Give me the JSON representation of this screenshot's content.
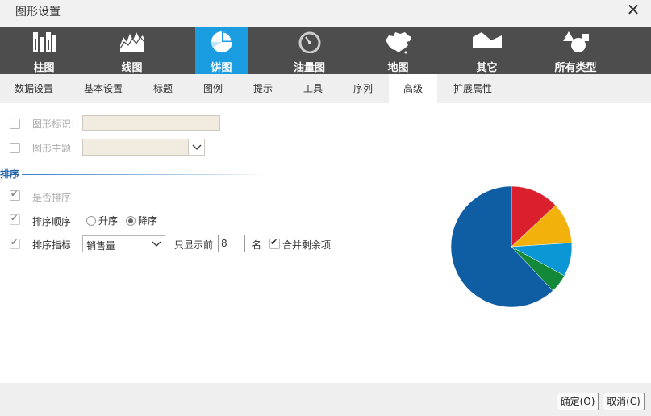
{
  "window": {
    "title": "图形设置",
    "close_icon": "close-icon"
  },
  "chart_types": [
    {
      "label": "柱图",
      "icon": "bar-chart-icon"
    },
    {
      "label": "线图",
      "icon": "line-chart-icon"
    },
    {
      "label": "饼图",
      "icon": "pie-chart-icon"
    },
    {
      "label": "油量图",
      "icon": "gauge-chart-icon"
    },
    {
      "label": "地图",
      "icon": "map-chart-icon"
    },
    {
      "label": "其它",
      "icon": "other-chart-icon"
    },
    {
      "label": "所有类型",
      "icon": "all-types-icon"
    }
  ],
  "active_chart_type": "饼图",
  "tabs": [
    "数据设置",
    "基本设置",
    "标题",
    "图例",
    "提示",
    "工具",
    "序列",
    "高级",
    "扩展属性"
  ],
  "active_tab": "高级",
  "form": {
    "chart_id_label": "图形标识:",
    "chart_id_value": "",
    "chart_theme_label": "图形主题",
    "chart_theme_value": "",
    "sort_section": "排序",
    "is_sort_label": "是否排序",
    "is_sort_checked": true,
    "sort_order_label": "排序顺序",
    "sort_asc_label": "升序",
    "sort_desc_label": "降序",
    "sort_order_selected": "降序",
    "sort_metric_label": "排序指标",
    "sort_metric_value": "销售量",
    "show_top_label": "只显示前",
    "show_top_value": "8",
    "show_top_unit": "名",
    "merge_rest_label": "合并剩余项",
    "merge_rest_checked": true
  },
  "chart_data": {
    "type": "pie",
    "values": [
      13,
      11,
      9,
      5,
      62
    ],
    "colors": [
      "#d9202c",
      "#f3b10b",
      "#0b96d6",
      "#128838",
      "#0f5ea3"
    ]
  },
  "footer": {
    "ok_label": "确定(O)",
    "cancel_label": "取消(C)"
  }
}
